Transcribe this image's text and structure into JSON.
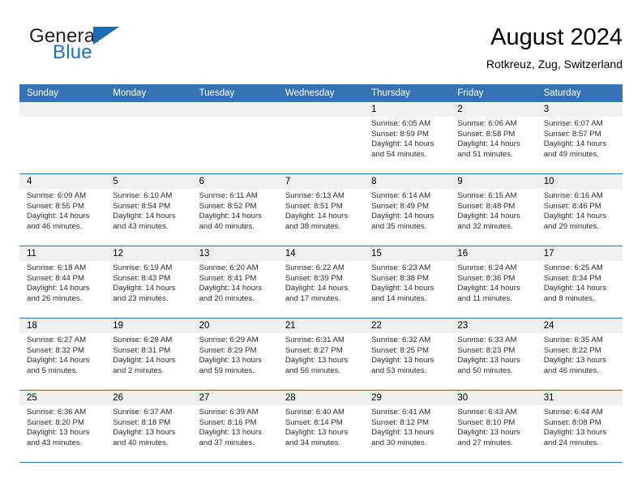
{
  "brand": {
    "general": "General",
    "blue": "Blue",
    "flag_icon": "brand-flag-icon"
  },
  "header": {
    "title": "August 2024",
    "subtitle": "Rotkreuz, Zug, Switzerland"
  },
  "colors": {
    "header_blue": "#3573b3",
    "brand_blue": "#1d71b8",
    "day_band_gray": "#f0f0f0",
    "text": "#000000"
  },
  "calendar": {
    "day_headers": [
      "Sunday",
      "Monday",
      "Tuesday",
      "Wednesday",
      "Thursday",
      "Friday",
      "Saturday"
    ],
    "weeks": [
      [
        {
          "day": "",
          "empty": true
        },
        {
          "day": "",
          "empty": true
        },
        {
          "day": "",
          "empty": true
        },
        {
          "day": "",
          "empty": true
        },
        {
          "day": "1",
          "sunrise": "Sunrise: 6:05 AM",
          "sunset": "Sunset: 8:59 PM",
          "daylight": "Daylight: 14 hours and 54 minutes."
        },
        {
          "day": "2",
          "sunrise": "Sunrise: 6:06 AM",
          "sunset": "Sunset: 8:58 PM",
          "daylight": "Daylight: 14 hours and 51 minutes."
        },
        {
          "day": "3",
          "sunrise": "Sunrise: 6:07 AM",
          "sunset": "Sunset: 8:57 PM",
          "daylight": "Daylight: 14 hours and 49 minutes."
        }
      ],
      [
        {
          "day": "4",
          "sunrise": "Sunrise: 6:09 AM",
          "sunset": "Sunset: 8:55 PM",
          "daylight": "Daylight: 14 hours and 46 minutes."
        },
        {
          "day": "5",
          "sunrise": "Sunrise: 6:10 AM",
          "sunset": "Sunset: 8:54 PM",
          "daylight": "Daylight: 14 hours and 43 minutes."
        },
        {
          "day": "6",
          "sunrise": "Sunrise: 6:11 AM",
          "sunset": "Sunset: 8:52 PM",
          "daylight": "Daylight: 14 hours and 40 minutes."
        },
        {
          "day": "7",
          "sunrise": "Sunrise: 6:13 AM",
          "sunset": "Sunset: 8:51 PM",
          "daylight": "Daylight: 14 hours and 38 minutes."
        },
        {
          "day": "8",
          "sunrise": "Sunrise: 6:14 AM",
          "sunset": "Sunset: 8:49 PM",
          "daylight": "Daylight: 14 hours and 35 minutes."
        },
        {
          "day": "9",
          "sunrise": "Sunrise: 6:15 AM",
          "sunset": "Sunset: 8:48 PM",
          "daylight": "Daylight: 14 hours and 32 minutes."
        },
        {
          "day": "10",
          "sunrise": "Sunrise: 6:16 AM",
          "sunset": "Sunset: 8:46 PM",
          "daylight": "Daylight: 14 hours and 29 minutes."
        }
      ],
      [
        {
          "day": "11",
          "sunrise": "Sunrise: 6:18 AM",
          "sunset": "Sunset: 8:44 PM",
          "daylight": "Daylight: 14 hours and 26 minutes."
        },
        {
          "day": "12",
          "sunrise": "Sunrise: 6:19 AM",
          "sunset": "Sunset: 8:43 PM",
          "daylight": "Daylight: 14 hours and 23 minutes."
        },
        {
          "day": "13",
          "sunrise": "Sunrise: 6:20 AM",
          "sunset": "Sunset: 8:41 PM",
          "daylight": "Daylight: 14 hours and 20 minutes."
        },
        {
          "day": "14",
          "sunrise": "Sunrise: 6:22 AM",
          "sunset": "Sunset: 8:39 PM",
          "daylight": "Daylight: 14 hours and 17 minutes."
        },
        {
          "day": "15",
          "sunrise": "Sunrise: 6:23 AM",
          "sunset": "Sunset: 8:38 PM",
          "daylight": "Daylight: 14 hours and 14 minutes."
        },
        {
          "day": "16",
          "sunrise": "Sunrise: 6:24 AM",
          "sunset": "Sunset: 8:36 PM",
          "daylight": "Daylight: 14 hours and 11 minutes."
        },
        {
          "day": "17",
          "sunrise": "Sunrise: 6:25 AM",
          "sunset": "Sunset: 8:34 PM",
          "daylight": "Daylight: 14 hours and 8 minutes."
        }
      ],
      [
        {
          "day": "18",
          "sunrise": "Sunrise: 6:27 AM",
          "sunset": "Sunset: 8:32 PM",
          "daylight": "Daylight: 14 hours and 5 minutes."
        },
        {
          "day": "19",
          "sunrise": "Sunrise: 6:28 AM",
          "sunset": "Sunset: 8:31 PM",
          "daylight": "Daylight: 14 hours and 2 minutes."
        },
        {
          "day": "20",
          "sunrise": "Sunrise: 6:29 AM",
          "sunset": "Sunset: 8:29 PM",
          "daylight": "Daylight: 13 hours and 59 minutes."
        },
        {
          "day": "21",
          "sunrise": "Sunrise: 6:31 AM",
          "sunset": "Sunset: 8:27 PM",
          "daylight": "Daylight: 13 hours and 56 minutes."
        },
        {
          "day": "22",
          "sunrise": "Sunrise: 6:32 AM",
          "sunset": "Sunset: 8:25 PM",
          "daylight": "Daylight: 13 hours and 53 minutes."
        },
        {
          "day": "23",
          "sunrise": "Sunrise: 6:33 AM",
          "sunset": "Sunset: 8:23 PM",
          "daylight": "Daylight: 13 hours and 50 minutes."
        },
        {
          "day": "24",
          "sunrise": "Sunrise: 6:35 AM",
          "sunset": "Sunset: 8:22 PM",
          "daylight": "Daylight: 13 hours and 46 minutes."
        }
      ],
      [
        {
          "day": "25",
          "sunrise": "Sunrise: 6:36 AM",
          "sunset": "Sunset: 8:20 PM",
          "daylight": "Daylight: 13 hours and 43 minutes."
        },
        {
          "day": "26",
          "sunrise": "Sunrise: 6:37 AM",
          "sunset": "Sunset: 8:18 PM",
          "daylight": "Daylight: 13 hours and 40 minutes."
        },
        {
          "day": "27",
          "sunrise": "Sunrise: 6:39 AM",
          "sunset": "Sunset: 8:16 PM",
          "daylight": "Daylight: 13 hours and 37 minutes."
        },
        {
          "day": "28",
          "sunrise": "Sunrise: 6:40 AM",
          "sunset": "Sunset: 8:14 PM",
          "daylight": "Daylight: 13 hours and 34 minutes."
        },
        {
          "day": "29",
          "sunrise": "Sunrise: 6:41 AM",
          "sunset": "Sunset: 8:12 PM",
          "daylight": "Daylight: 13 hours and 30 minutes."
        },
        {
          "day": "30",
          "sunrise": "Sunrise: 6:43 AM",
          "sunset": "Sunset: 8:10 PM",
          "daylight": "Daylight: 13 hours and 27 minutes."
        },
        {
          "day": "31",
          "sunrise": "Sunrise: 6:44 AM",
          "sunset": "Sunset: 8:08 PM",
          "daylight": "Daylight: 13 hours and 24 minutes."
        }
      ]
    ]
  }
}
